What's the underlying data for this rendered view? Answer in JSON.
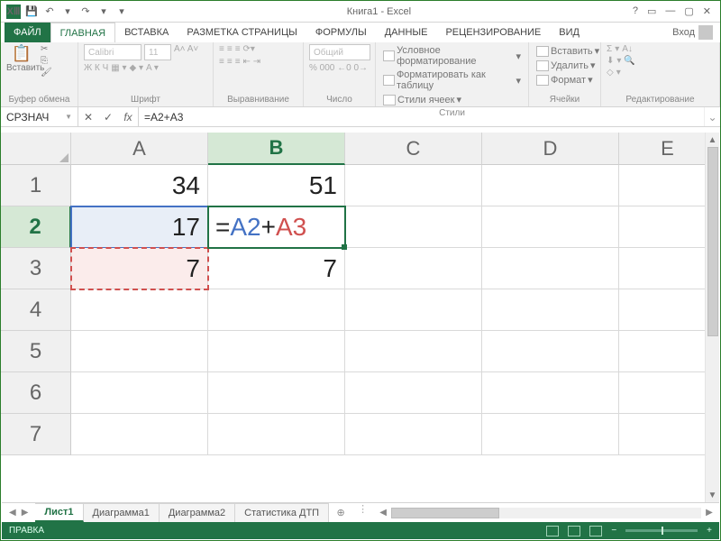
{
  "titlebar": {
    "app_icon": "XⅢ",
    "title": "Книга1 - Excel",
    "qat": {
      "save": "💾",
      "undo": "↶",
      "redo": "↷",
      "dd": "▾"
    },
    "winctl": {
      "help": "?",
      "ribbon": "▭",
      "min": "—",
      "max": "▢",
      "close": "✕"
    }
  },
  "tabs": {
    "file": "ФАЙЛ",
    "home": "ГЛАВНАЯ",
    "insert": "ВСТАВКА",
    "layout": "РАЗМЕТКА СТРАНИЦЫ",
    "formulas": "ФОРМУЛЫ",
    "data": "ДАННЫЕ",
    "review": "РЕЦЕНЗИРОВАНИЕ",
    "view": "ВИД",
    "login": "Вход"
  },
  "ribbon": {
    "clipboard": {
      "label": "Буфер обмена",
      "paste": "Вставить"
    },
    "font": {
      "label": "Шрифт",
      "name": "Calibri",
      "size": "11",
      "buttons": "Ж  К  Ч",
      "extra": "A˄ A˅"
    },
    "align": {
      "label": "Выравнивание"
    },
    "number": {
      "label": "Число",
      "format": "Общий",
      "icons": "%  000  ←0  0→"
    },
    "styles": {
      "label": "Стили",
      "cond": "Условное форматирование",
      "table": "Форматировать как таблицу",
      "cell": "Стили ячеек"
    },
    "cells": {
      "label": "Ячейки",
      "ins": "Вставить",
      "del": "Удалить",
      "fmt": "Формат"
    },
    "edit": {
      "label": "Редактирование",
      "sum": "Σ",
      "fill": "⬇",
      "clear": "◇"
    }
  },
  "formulabar": {
    "name": "СРЗНАЧ",
    "cancel": "✕",
    "enter": "✓",
    "fx": "fx",
    "formula": "=A2+A3"
  },
  "grid": {
    "cols": [
      "A",
      "B",
      "C",
      "D",
      "E"
    ],
    "rows": [
      "1",
      "2",
      "3",
      "4",
      "5",
      "6",
      "7"
    ],
    "A1": "34",
    "A2": "17",
    "A3": "7",
    "B1": "51",
    "B2_eq": "=",
    "B2_r1": "A2",
    "B2_op": "+",
    "B2_r2": "A3",
    "B3": "7"
  },
  "sheets": {
    "s1": "Лист1",
    "s2": "Диаграмма1",
    "s3": "Диаграмма2",
    "s4": "Статистика ДТП",
    "add": "⊕",
    "nav": {
      "first": "⏮",
      "prev": "◀",
      "next": "▶",
      "sep": "⋮"
    }
  },
  "status": {
    "mode": "ПРАВКА",
    "zoom_minus": "−",
    "zoom_plus": "+"
  }
}
